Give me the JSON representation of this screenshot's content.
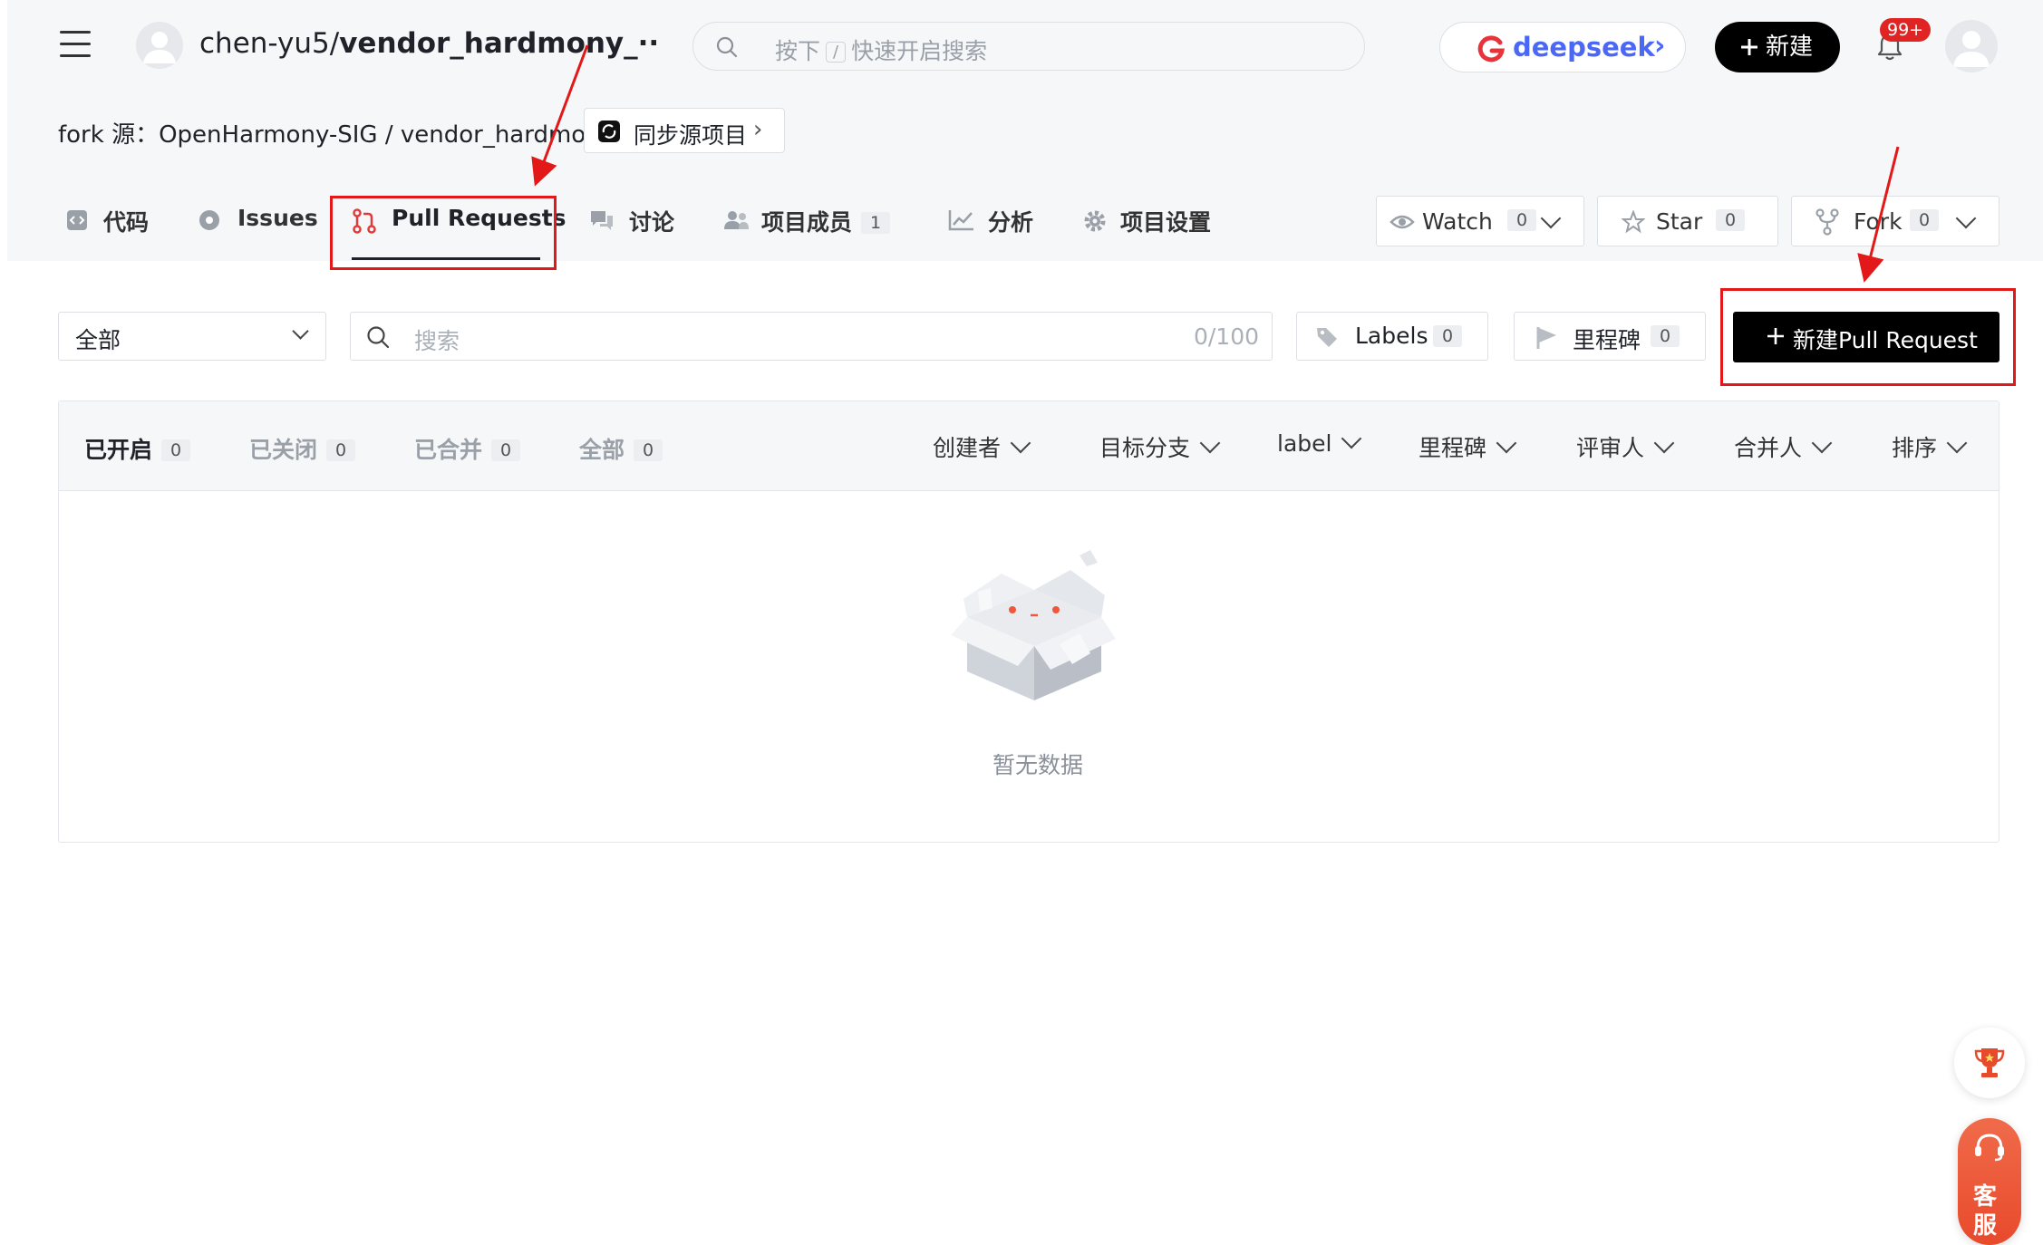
{
  "topbar": {
    "repo_owner": "chen-yu5/",
    "repo_name": "vendor_hardmony_··",
    "search_placeholder_pre": "按下",
    "search_key": "/",
    "search_placeholder_post": "快速开启搜索",
    "deepseek_label": "deepseek",
    "deepseek_chevron": "›",
    "new_label": "新建",
    "notification_badge": "99+"
  },
  "repo": {
    "fork_source": "fork 源：OpenHarmony-SIG / vendor_hardmony",
    "sync_label": "同步源项目",
    "tabs": [
      {
        "label": "代码"
      },
      {
        "label": "Issues"
      },
      {
        "label": "Pull Requests"
      },
      {
        "label": "讨论"
      },
      {
        "label": "项目成员",
        "count": "1"
      },
      {
        "label": "分析"
      },
      {
        "label": "项目设置"
      }
    ],
    "watch": {
      "label": "Watch",
      "count": "0"
    },
    "star": {
      "label": "Star",
      "count": "0"
    },
    "fork": {
      "label": "Fork",
      "count": "0"
    }
  },
  "toolbar": {
    "scope_select": "全部",
    "search_placeholder": "搜索",
    "search_counter": "0/100",
    "labels": {
      "label": "Labels",
      "count": "0"
    },
    "milestones": {
      "label": "里程碑",
      "count": "0"
    },
    "new_pr_label": "新建Pull Request"
  },
  "list": {
    "states": [
      {
        "label": "已开启",
        "count": "0"
      },
      {
        "label": "已关闭",
        "count": "0"
      },
      {
        "label": "已合并",
        "count": "0"
      },
      {
        "label": "全部",
        "count": "0"
      }
    ],
    "filters": [
      "创建者",
      "目标分支",
      "label",
      "里程碑",
      "评审人",
      "合并人",
      "排序"
    ],
    "empty_text": "暂无数据"
  },
  "floating": {
    "service_label_1": "客",
    "service_label_2": "服"
  },
  "colors": {
    "accent_black": "#000000",
    "deepseek_blue": "#4a68f5",
    "annotation_red": "#e31818",
    "badge_red": "#e02424"
  }
}
